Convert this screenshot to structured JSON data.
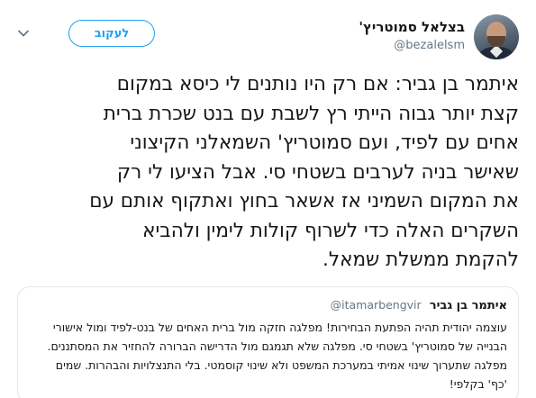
{
  "author": {
    "display_name": "בצלאל סמוטריץ'",
    "handle": "@bezalelsm"
  },
  "follow_button": {
    "label": "לעקוב"
  },
  "tweet": {
    "text": "איתמר בן גביר: אם רק היו נותנים לי כיסא במקום\nקצת יותר גבוה הייתי רץ לשבת עם בנט שכרת ברית\nאחים עם לפיד, ועם סמוטריץ' השמאלני הקיצוני\nשאישר בניה לערבים בשטחי סי. אבל הציעו לי רק\nאת המקום השמיני אז אשאר בחוץ ואתקוף אותם עם\nהשקרים האלה כדי לשרוף קולות לימין ולהביא\nלהקמת ממשלת שמאל."
  },
  "quoted_tweet": {
    "display_name": "איתמר בן גביר",
    "handle": "@itamarbengvir",
    "text": "עוצמה יהודית תהיה הפתעת הבחירות! מפלגה חזקה מול ברית האחים של בנט-לפיד ומול אישורי\nהבנייה של סמוטריץ' בשטחי סי. מפלגה שלא תגמגם מול הדרישה הברורה להחזיר את המסתננים.\nמפלגה שתערוך שינוי אמיתי במערכת המשפט ולא שינוי קוסמטי. בלי התנצלויות והבהרות. שמים\n'כף' בקלפי!"
  },
  "icons": {
    "menu": "chevron-down-icon"
  },
  "colors": {
    "accent": "#1da1f2",
    "secondary_text": "#657786",
    "border": "#e1e8ed"
  }
}
